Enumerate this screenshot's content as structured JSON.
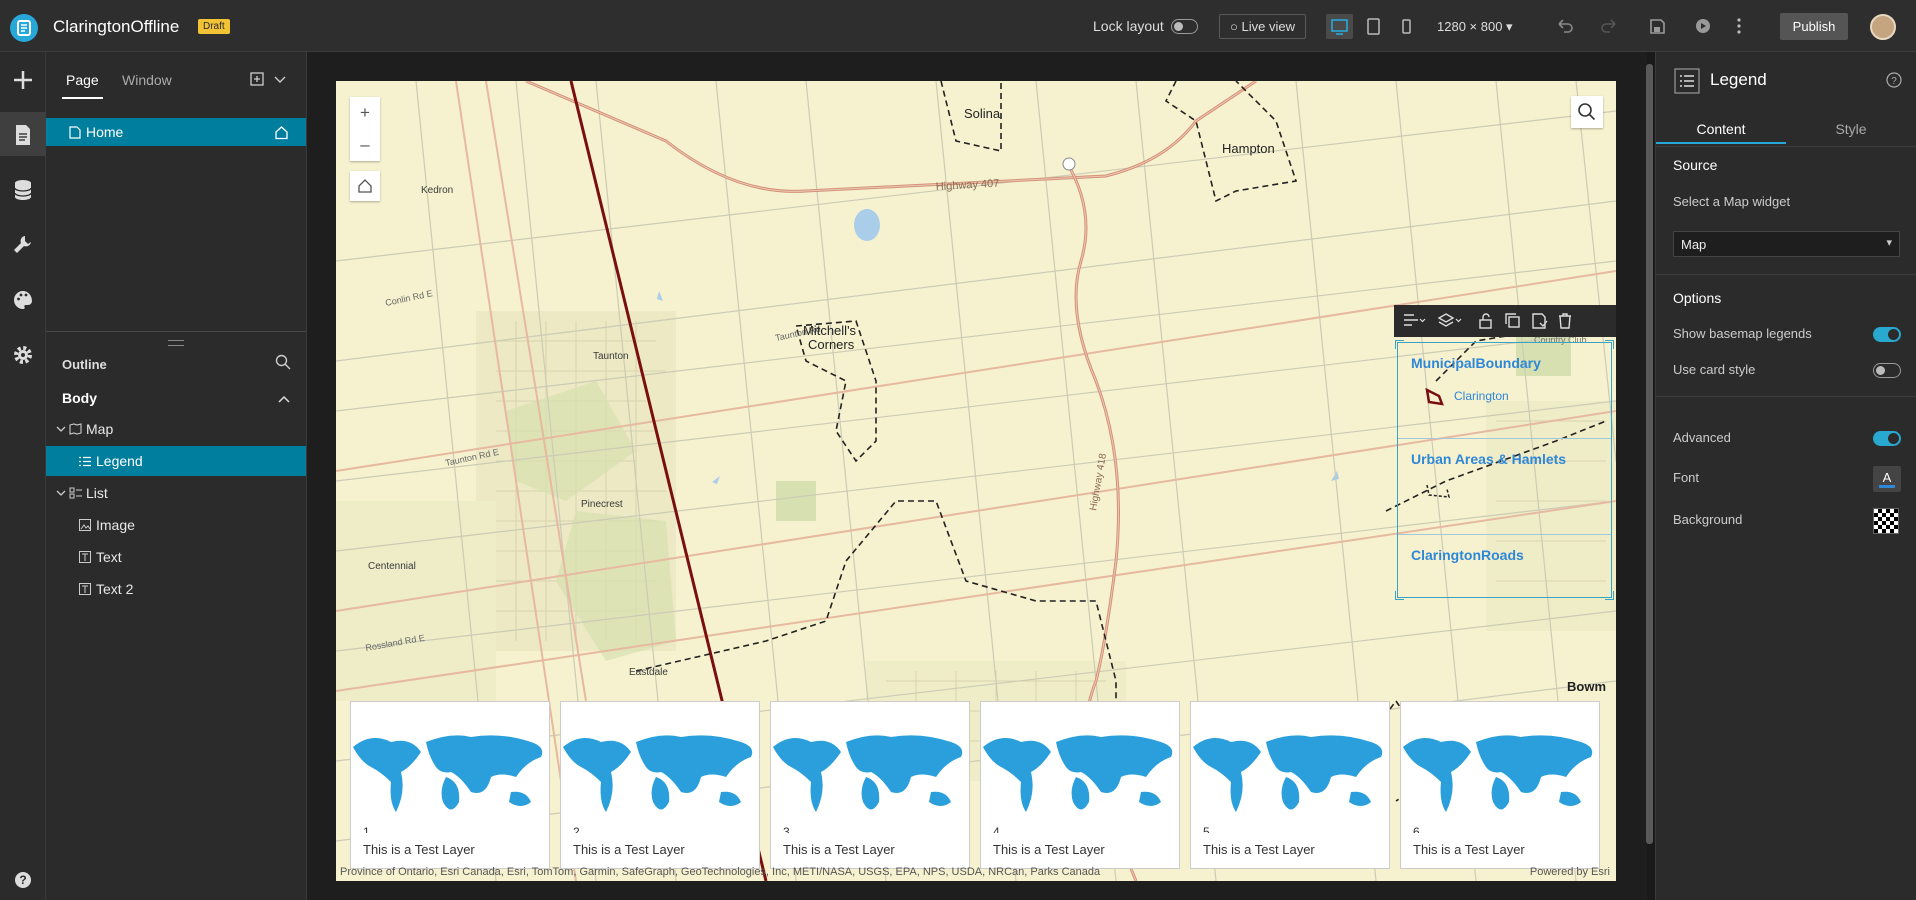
{
  "header": {
    "app_title": "ClaringtonOffline",
    "badge": "Draft",
    "lock_layout": "Lock layout",
    "live_view": "Live view",
    "screen_size": "1280 × 800",
    "publish": "Publish"
  },
  "rail": {
    "items": [
      "add-icon",
      "page-icon",
      "data-icon",
      "widget-tools-icon",
      "theme-icon",
      "settings-icon",
      "help-icon"
    ]
  },
  "page_panel": {
    "tabs": [
      "Page",
      "Window"
    ],
    "pages": [
      {
        "label": "Home"
      }
    ],
    "outline_label": "Outline",
    "body_label": "Body",
    "tree": [
      {
        "label": "Map",
        "level": 1,
        "expanded": true
      },
      {
        "label": "Legend",
        "level": 2,
        "selected": true
      },
      {
        "label": "List",
        "level": 1,
        "expanded": true
      },
      {
        "label": "Image",
        "level": 2
      },
      {
        "label": "Text",
        "level": 2
      },
      {
        "label": "Text 2",
        "level": 2
      }
    ]
  },
  "map": {
    "places": [
      "Solina",
      "Hampton",
      "Kedron",
      "Mitchell's",
      "Corners",
      "Taunton",
      "Pinecrest",
      "Centennial",
      "Eastdale",
      "Taunton Rd",
      "Highway 407",
      "Highway 418",
      "Conlin Rd E",
      "Rossland Rd E",
      "Country Club",
      "Bowm"
    ],
    "legend": {
      "layers": [
        {
          "title": "MunicipalBoundary",
          "item": "Clarington"
        },
        {
          "title": "Urban Areas & Hamlets",
          "item": ""
        },
        {
          "title": "ClaringtonRoads",
          "item": ""
        }
      ]
    },
    "cards": [
      {
        "num": "1",
        "text": "This is a Test Layer"
      },
      {
        "num": "2",
        "text": "This is a Test Layer"
      },
      {
        "num": "3",
        "text": "This is a Test Layer"
      },
      {
        "num": "4",
        "text": "This is a Test Layer"
      },
      {
        "num": "5",
        "text": "This is a Test Layer"
      },
      {
        "num": "6",
        "text": "This is a Test Layer"
      }
    ],
    "attribution": "Province of Ontario, Esri Canada, Esri, TomTom, Garmin, SafeGraph, GeoTechnologies, Inc, METI/NASA, USGS, EPA, NPS, USDA, NRCan, Parks Canada",
    "powered_by": "Powered by Esri"
  },
  "right_panel": {
    "title": "Legend",
    "tabs": [
      "Content",
      "Style"
    ],
    "source_label": "Source",
    "select_hint": "Select a Map widget",
    "map_select": "Map",
    "options_label": "Options",
    "show_basemap": "Show basemap legends",
    "use_card_style": "Use card style",
    "advanced": "Advanced",
    "font": "Font",
    "background": "Background",
    "toggles": {
      "show_basemap": true,
      "use_card_style": false,
      "advanced": true
    }
  },
  "colors": {
    "accent": "#007e9e",
    "brand": "#28a8d8",
    "badge": "#f2c335",
    "legend_link": "#2f87d8",
    "boundary": "#7a0f0f"
  }
}
